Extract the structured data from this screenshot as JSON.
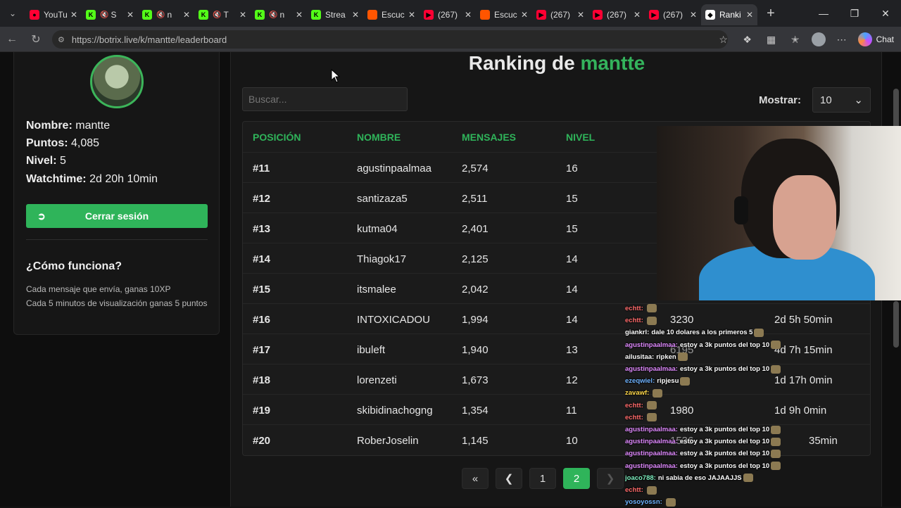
{
  "browser": {
    "tabs": [
      {
        "title": "YouTube",
        "fav_color": "#ff0033",
        "fav_text": "●",
        "muted": false
      },
      {
        "title": "S",
        "fav_color": "#53fc18",
        "fav_text": "K",
        "muted": true
      },
      {
        "title": "n",
        "fav_color": "#53fc18",
        "fav_text": "K",
        "muted": true
      },
      {
        "title": "T",
        "fav_color": "#53fc18",
        "fav_text": "K",
        "muted": true
      },
      {
        "title": "n",
        "fav_color": "#53fc18",
        "fav_text": "K",
        "muted": true
      },
      {
        "title": "Strea",
        "fav_color": "#53fc18",
        "fav_text": "K",
        "muted": false
      },
      {
        "title": "Escuc",
        "fav_color": "#ff5500",
        "fav_text": "",
        "muted": false
      },
      {
        "title": "(267)",
        "fav_color": "#ff0033",
        "fav_text": "▶",
        "muted": false
      },
      {
        "title": "Escuc",
        "fav_color": "#ff5500",
        "fav_text": "",
        "muted": false
      },
      {
        "title": "(267)",
        "fav_color": "#ff0033",
        "fav_text": "▶",
        "muted": false
      },
      {
        "title": "(267)",
        "fav_color": "#ff0033",
        "fav_text": "▶",
        "muted": false
      },
      {
        "title": "(267)",
        "fav_color": "#ff0033",
        "fav_text": "▶",
        "muted": false
      },
      {
        "title": "Ranki",
        "fav_color": "#ffffff",
        "fav_text": "◆",
        "muted": false
      }
    ],
    "url": "https://botrix.live/k/mantte/leaderboard",
    "chat_label": "Chat"
  },
  "profile": {
    "nombre_label": "Nombre:",
    "nombre": "mantte",
    "puntos_label": "Puntos:",
    "puntos": "4,085",
    "nivel_label": "Nivel:",
    "nivel": "5",
    "watch_label": "Watchtime:",
    "watch": "2d 20h 10min",
    "logout": "Cerrar sesión",
    "how_title": "¿Cómo funciona?",
    "how_1": "Cada mensaje que envía, ganas 10XP",
    "how_2": "Cada 5 minutos de visualización ganas 5 puntos"
  },
  "ranking": {
    "title_prefix": "Ranking de",
    "title_user": "mantte",
    "search_placeholder": "Buscar...",
    "mostrar_label": "Mostrar:",
    "mostrar_value": "10",
    "headers": {
      "pos": "POSICIÓN",
      "name": "NOMBRE",
      "msgs": "MENSAJES",
      "lvl": "NIVEL"
    },
    "rows": [
      {
        "pos": "#11",
        "name": "agustinpaalmaa",
        "msgs": "2,574",
        "lvl": "16"
      },
      {
        "pos": "#12",
        "name": "santizaza5",
        "msgs": "2,511",
        "lvl": "15"
      },
      {
        "pos": "#13",
        "name": "kutma04",
        "msgs": "2,401",
        "lvl": "15"
      },
      {
        "pos": "#14",
        "name": "Thiagok17",
        "msgs": "2,125",
        "lvl": "14"
      },
      {
        "pos": "#15",
        "name": "itsmalee",
        "msgs": "2,042",
        "lvl": "14"
      },
      {
        "pos": "#16",
        "name": "INTOXICADOU",
        "msgs": "1,994",
        "lvl": "14"
      },
      {
        "pos": "#17",
        "name": "ibuleft",
        "msgs": "1,940",
        "lvl": "13"
      },
      {
        "pos": "#18",
        "name": "lorenzeti",
        "msgs": "1,673",
        "lvl": "12"
      },
      {
        "pos": "#19",
        "name": "skibidinachogng",
        "msgs": "1,354",
        "lvl": "11"
      },
      {
        "pos": "#20",
        "name": "RoberJoselin",
        "msgs": "1,145",
        "lvl": "10"
      }
    ],
    "partial": {
      "r16_points": "3230",
      "r16_watch": "2d 5h 50min",
      "r17_points": "6195",
      "r17_watch": "4d 7h 15min",
      "r18_watch": "1d 17h 0min",
      "r19_points": "1980",
      "r19_watch": "1d 9h 0min",
      "r20_points": "1536",
      "r20_watch": "35min"
    },
    "pages": [
      "1",
      "2"
    ]
  },
  "chat": [
    {
      "user": "echtt:",
      "color": "#ff6b6b",
      "text": ""
    },
    {
      "user": "echtt:",
      "color": "#ff6b6b",
      "text": ""
    },
    {
      "user": "giankrl:",
      "color": "#ffffff",
      "text": "dale 10 dolares a los primeros 5"
    },
    {
      "user": "agustinpaalmaa:",
      "color": "#e08aff",
      "text": "estoy a 3k puntos del top 10"
    },
    {
      "user": "ailusitaa:",
      "color": "#ffffff",
      "text": "ripken"
    },
    {
      "user": "agustinpaalmaa:",
      "color": "#e08aff",
      "text": "estoy a 3k puntos del top 10"
    },
    {
      "user": "ezeqwiel:",
      "color": "#6fb3ff",
      "text": "ripjesu"
    },
    {
      "user": "zavawf:",
      "color": "#ffd84a",
      "text": ""
    },
    {
      "user": "echtt:",
      "color": "#ff6b6b",
      "text": ""
    },
    {
      "user": "echtt:",
      "color": "#ff6b6b",
      "text": ""
    },
    {
      "user": "agustinpaalmaa:",
      "color": "#e08aff",
      "text": "estoy a 3k puntos del top 10"
    },
    {
      "user": "agustinpaalmaa:",
      "color": "#e08aff",
      "text": "estoy a 3k puntos del top 10"
    },
    {
      "user": "agustinpaalmaa:",
      "color": "#e08aff",
      "text": "estoy a 3k puntos del top 10"
    },
    {
      "user": "agustinpaalmaa:",
      "color": "#e08aff",
      "text": "estoy a 3k puntos del top 10"
    },
    {
      "user": "joaco788:",
      "color": "#7ef0c0",
      "text": "ni sabia de eso JAJAAJJS"
    },
    {
      "user": "echtt:",
      "color": "#ff6b6b",
      "text": ""
    },
    {
      "user": "yosoyossn:",
      "color": "#6fb3ff",
      "text": ""
    }
  ]
}
